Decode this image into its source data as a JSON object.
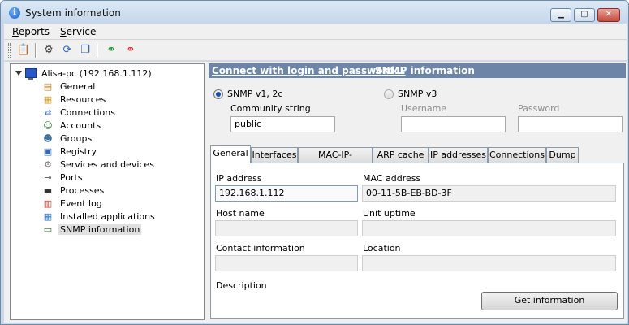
{
  "window": {
    "title": "System information",
    "icon": "info-icon"
  },
  "menu": [
    {
      "label_u": "R",
      "label_rest": "eports"
    },
    {
      "label_u": "S",
      "label_rest": "ervice"
    }
  ],
  "toolbar": {
    "icons": [
      "report-icon",
      "settings-icon",
      "refresh-icon",
      "copy-icon",
      "connect-icon",
      "disconnect-icon"
    ]
  },
  "tree": {
    "root": "Alisa-pc (192.168.1.112)",
    "items": [
      {
        "label": "General",
        "icon": "general-icon"
      },
      {
        "label": "Resources",
        "icon": "resources-icon"
      },
      {
        "label": "Connections",
        "icon": "connections-icon"
      },
      {
        "label": "Accounts",
        "icon": "accounts-icon"
      },
      {
        "label": "Groups",
        "icon": "groups-icon"
      },
      {
        "label": "Registry",
        "icon": "registry-icon"
      },
      {
        "label": "Services and devices",
        "icon": "services-icon"
      },
      {
        "label": "Ports",
        "icon": "ports-icon"
      },
      {
        "label": "Processes",
        "icon": "processes-icon"
      },
      {
        "label": "Event log",
        "icon": "event-log-icon"
      },
      {
        "label": "Installed applications",
        "icon": "applications-icon"
      },
      {
        "label": "SNMP information",
        "icon": "snmp-icon",
        "selected": true
      }
    ]
  },
  "header": {
    "connect_link": "Connect with login and password...",
    "section_title": "SNMP information"
  },
  "snmp": {
    "v1_label": "SNMP v1, 2c",
    "v3_label": "SNMP v3",
    "community_label": "Community string",
    "community_value": "public",
    "username_label": "Username",
    "password_label": "Password"
  },
  "tabs": [
    "General",
    "Interfaces",
    "MAC-IP-Interface",
    "ARP cache",
    "IP addresses",
    "Connections",
    "Dump"
  ],
  "general": {
    "ip_label": "IP address",
    "ip_value": "192.168.1.112",
    "mac_label": "MAC address",
    "mac_value": "00-11-5B-EB-BD-3F",
    "host_label": "Host name",
    "host_value": "",
    "uptime_label": "Unit uptime",
    "uptime_value": "",
    "contact_label": "Contact information",
    "contact_value": "",
    "location_label": "Location",
    "location_value": "",
    "description_label": "Description",
    "get_info_button": "Get information"
  }
}
